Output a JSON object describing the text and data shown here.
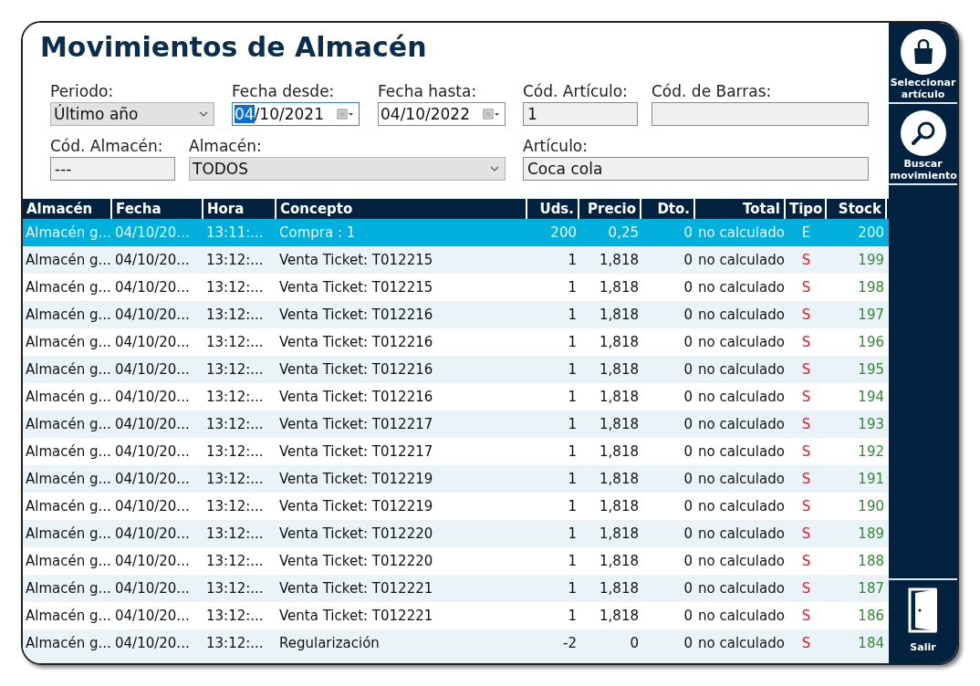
{
  "title": "Movimientos de Almacén",
  "filter_rows": [
    [
      {
        "kind": "select",
        "label": "Periodo:",
        "value": "Último año",
        "focused": false
      },
      {
        "kind": "date",
        "label": "Fecha desde:",
        "value": "04/10/2021",
        "focused": true
      },
      {
        "kind": "date",
        "label": "Fecha hasta:",
        "value": "04/10/2022",
        "focused": false
      },
      {
        "kind": "text",
        "label": "Cód. Artículo:",
        "value": "1",
        "focused": false
      },
      {
        "kind": "text",
        "label": "Cód. de Barras:",
        "focused": false
      }
    ],
    [
      {
        "kind": "text",
        "label": "Cód. Almacén:",
        "value": "---",
        "focused": false
      },
      {
        "kind": "select",
        "label": "Almacén:",
        "value": "TODOS",
        "focused": false
      },
      {
        "kind": "text",
        "label": "Artículo:",
        "value": "Coca cola",
        "focused": false
      }
    ]
  ],
  "table": {
    "columns": [
      "Almacén",
      "Fecha",
      "Hora",
      "Concepto",
      "Uds.",
      "Precio",
      "Dto.",
      "Total",
      "Tipo",
      "Stock"
    ],
    "rows": [
      {
        "selected": true,
        "cells": [
          "Almacén g...",
          "04/10/20...",
          "13:11:...",
          "Compra : 1",
          "200",
          "0,25",
          "0",
          "no calculado",
          "E",
          "200"
        ]
      },
      {
        "selected": false,
        "cells": [
          "Almacén g...",
          "04/10/20...",
          "13:12:...",
          "Venta Ticket: T012215",
          "1",
          "1,818",
          "0",
          "no calculado",
          "S",
          "199"
        ]
      },
      {
        "selected": false,
        "cells": [
          "Almacén g...",
          "04/10/20...",
          "13:12:...",
          "Venta Ticket: T012215",
          "1",
          "1,818",
          "0",
          "no calculado",
          "S",
          "198"
        ]
      },
      {
        "selected": false,
        "cells": [
          "Almacén g...",
          "04/10/20...",
          "13:12:...",
          "Venta Ticket: T012216",
          "1",
          "1,818",
          "0",
          "no calculado",
          "S",
          "197"
        ]
      },
      {
        "selected": false,
        "cells": [
          "Almacén g...",
          "04/10/20...",
          "13:12:...",
          "Venta Ticket: T012216",
          "1",
          "1,818",
          "0",
          "no calculado",
          "S",
          "196"
        ]
      },
      {
        "selected": false,
        "cells": [
          "Almacén g...",
          "04/10/20...",
          "13:12:...",
          "Venta Ticket: T012216",
          "1",
          "1,818",
          "0",
          "no calculado",
          "S",
          "195"
        ]
      },
      {
        "selected": false,
        "cells": [
          "Almacén g...",
          "04/10/20...",
          "13:12:...",
          "Venta Ticket: T012216",
          "1",
          "1,818",
          "0",
          "no calculado",
          "S",
          "194"
        ]
      },
      {
        "selected": false,
        "cells": [
          "Almacén g...",
          "04/10/20...",
          "13:12:...",
          "Venta Ticket: T012217",
          "1",
          "1,818",
          "0",
          "no calculado",
          "S",
          "193"
        ]
      },
      {
        "selected": false,
        "cells": [
          "Almacén g...",
          "04/10/20...",
          "13:12:...",
          "Venta Ticket: T012217",
          "1",
          "1,818",
          "0",
          "no calculado",
          "S",
          "192"
        ]
      },
      {
        "selected": false,
        "cells": [
          "Almacén g...",
          "04/10/20...",
          "13:12:...",
          "Venta Ticket: T012219",
          "1",
          "1,818",
          "0",
          "no calculado",
          "S",
          "191"
        ]
      },
      {
        "selected": false,
        "cells": [
          "Almacén g...",
          "04/10/20...",
          "13:12:...",
          "Venta Ticket: T012219",
          "1",
          "1,818",
          "0",
          "no calculado",
          "S",
          "190"
        ]
      },
      {
        "selected": false,
        "cells": [
          "Almacén g...",
          "04/10/20...",
          "13:12:...",
          "Venta Ticket: T012220",
          "1",
          "1,818",
          "0",
          "no calculado",
          "S",
          "189"
        ]
      },
      {
        "selected": false,
        "cells": [
          "Almacén g...",
          "04/10/20...",
          "13:12:...",
          "Venta Ticket: T012220",
          "1",
          "1,818",
          "0",
          "no calculado",
          "S",
          "188"
        ]
      },
      {
        "selected": false,
        "cells": [
          "Almacén g...",
          "04/10/20...",
          "13:12:...",
          "Venta Ticket: T012221",
          "1",
          "1,818",
          "0",
          "no calculado",
          "S",
          "187"
        ]
      },
      {
        "selected": false,
        "cells": [
          "Almacén g...",
          "04/10/20...",
          "13:12:...",
          "Venta Ticket: T012221",
          "1",
          "1,818",
          "0",
          "no calculado",
          "S",
          "186"
        ]
      },
      {
        "selected": false,
        "cells": [
          "Almacén g...",
          "04/10/20...",
          "13:12:...",
          "Regularización",
          "-2",
          "0",
          "0",
          "no calculado",
          "S",
          "184"
        ]
      }
    ]
  },
  "sidebar": {
    "buttons": [
      {
        "kind": "bag",
        "label": "Seleccionar artículo"
      },
      {
        "kind": "search",
        "label": "Buscar movimiento"
      }
    ],
    "exit": {
      "kind": "exit",
      "label": "Salir"
    }
  }
}
